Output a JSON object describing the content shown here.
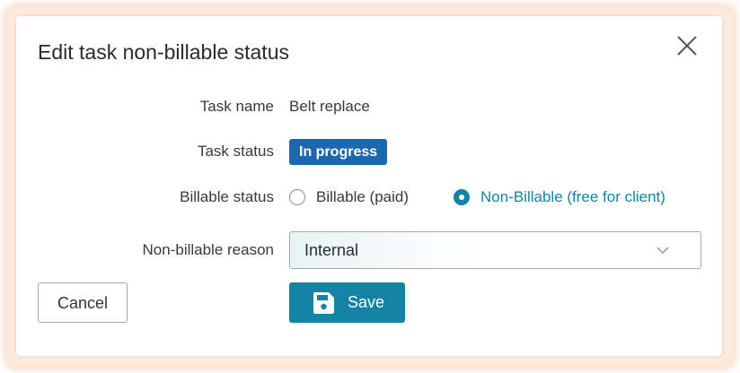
{
  "dialog": {
    "title": "Edit task non-billable status",
    "close_icon": "close-icon"
  },
  "fields": {
    "task_name_label": "Task name",
    "task_name_value": "Belt replace",
    "task_status_label": "Task status",
    "task_status_badge": "In progress",
    "billable_status_label": "Billable status",
    "billable_option": "Billable (paid)",
    "non_billable_option": "Non-Billable (free for client)",
    "selected_billable_status": "Non-Billable (free for client)",
    "reason_label": "Non-billable reason",
    "reason_value": "Internal"
  },
  "buttons": {
    "cancel_label": "Cancel",
    "save_label": "Save",
    "save_icon": "floppy-disk-icon"
  },
  "colors": {
    "accent": "#1584a4",
    "badge": "#1d67ae",
    "selected_option_text": "#1384a3",
    "frame_glow": "#f1be96"
  }
}
